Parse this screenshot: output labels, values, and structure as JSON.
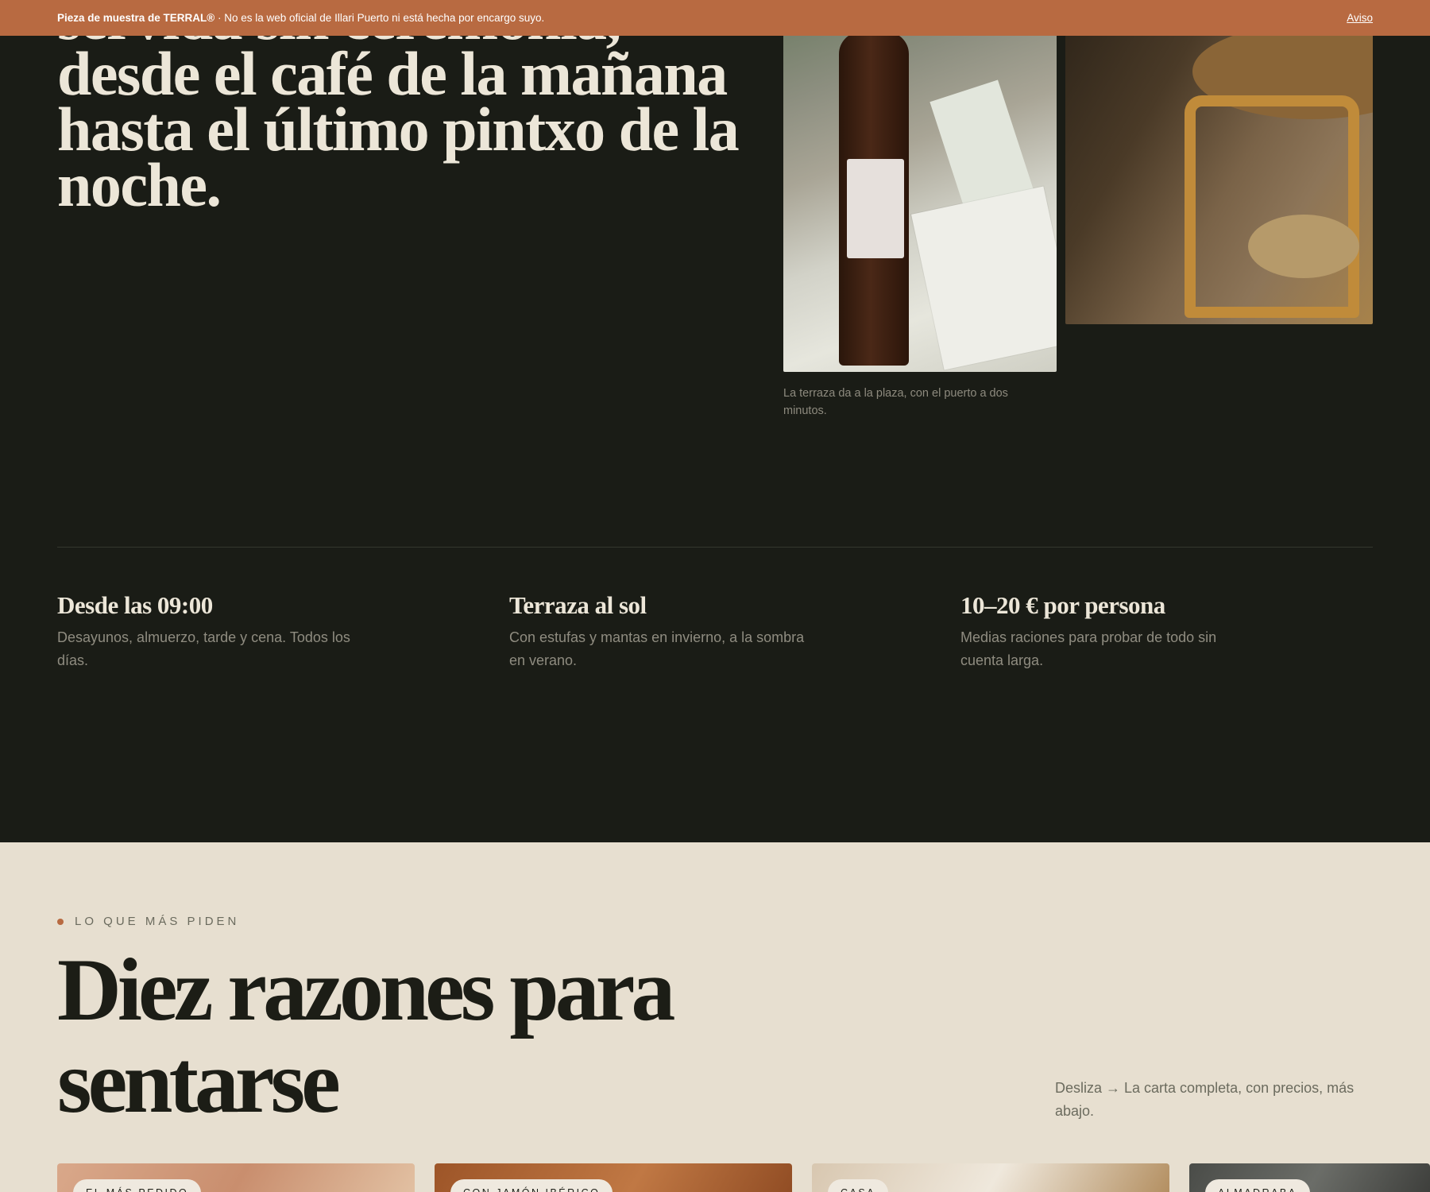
{
  "banner": {
    "brand": "Pieza de muestra de TERRAL®",
    "notice": " · No es la web oficial de Illari Puerto ni está hecha por encargo suyo.",
    "link": "Aviso"
  },
  "hero": {
    "title": "servida sin ceremonia, desde el café de la mañana hasta el último pintxo de la noche.",
    "caption": "La terraza da a la plaza, con el puerto a dos minutos."
  },
  "features": [
    {
      "title": "Desde las 09:00",
      "text": "Desayunos, almuerzo, tarde y cena. Todos los días."
    },
    {
      "title": "Terraza al sol",
      "text": "Con estufas y mantas en invierno, a la sombra en verano."
    },
    {
      "title": "10–20 € por persona",
      "text": "Medias raciones para probar de todo sin cuenta larga."
    }
  ],
  "popular": {
    "eyebrow": "LO QUE MÁS PIDEN",
    "title": "Diez razones para sentarse",
    "hint": "Desliza → La carta completa, con precios, más abajo."
  },
  "cards": [
    {
      "tag": "EL MÁS PEDIDO"
    },
    {
      "tag": "CON JAMÓN IBÉRICO"
    },
    {
      "tag": "CASA"
    },
    {
      "tag": "ALMADRABA"
    }
  ],
  "colors": {
    "accent": "#b86a41",
    "dark_bg": "#1a1c16",
    "light_bg": "#e7dfd0"
  }
}
